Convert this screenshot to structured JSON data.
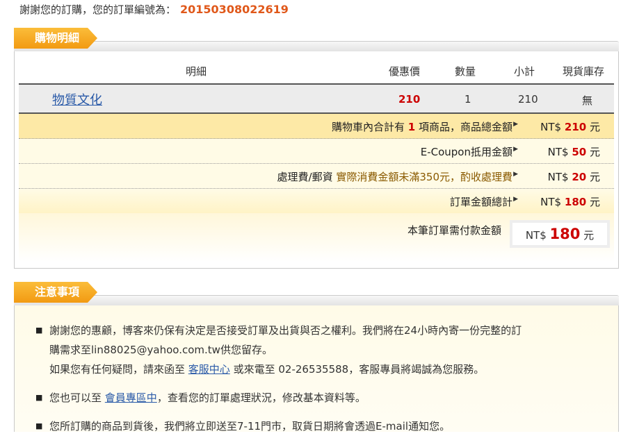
{
  "header": {
    "thanks_text": "謝謝您的訂購，您的訂單編號為：",
    "order_number": "20150308022619"
  },
  "section_details": {
    "title": "購物明細",
    "columns": [
      "明細",
      "優惠價",
      "數量",
      "小計",
      "現貨庫存"
    ],
    "items": [
      {
        "name": "物質文化",
        "price": "210",
        "qty": "1",
        "subtotal": "210",
        "stock": "無"
      }
    ],
    "summary": {
      "cart_prefix": "購物車內合計有",
      "cart_count": "1",
      "cart_suffix": "項商品，商品總金額",
      "cart_amount_prefix": "NT$",
      "cart_amount": "210",
      "cart_unit": "元",
      "coupon_label": "E-Coupon抵用金額",
      "coupon_prefix": "NT$",
      "coupon_amount": "50",
      "coupon_unit": "元",
      "fee_label": "處理費/郵資",
      "fee_note": "實際消費金額未滿350元，酌收處理費",
      "fee_prefix": "NT$",
      "fee_amount": "20",
      "fee_unit": "元",
      "total_label": "訂單金額總計",
      "total_prefix": "NT$",
      "total_amount": "180",
      "total_unit": "元",
      "pay_label": "本筆訂單需付款金額",
      "pay_prefix": "NT$",
      "pay_amount": "180",
      "pay_unit": "元"
    },
    "arrow_icon": "triangle-right-icon"
  },
  "section_notes": {
    "title": "注意事項",
    "note1_line1": "謝謝您的惠顧，博客來仍保有決定是否接受訂單及出貨與否之權利。我們將在24小時內寄一份完整的訂",
    "note1_line2": "購需求至lin88025@yahoo.com.tw供您留存。",
    "note1_line3_a": "如果您有任何疑問，請來函至",
    "note1_link": "客服中心",
    "note1_line3_b": "或來電至 02-26535588，客服專員將竭誠為您服務。",
    "note2_a": "您也可以至",
    "note2_link": "會員專區中",
    "note2_b": "，查看您的訂單處理狀況，修改基本資料等。",
    "note3": "您所訂購的商品到貨後，我們將立即送至7-11門市，取貨日期將會透過E-mail通知您。",
    "bullet_icon": "square-bullet-icon"
  },
  "colors": {
    "accent": "#f29a12",
    "price_red": "#cc0000",
    "link_blue": "#2a5aa8",
    "order_orange": "#e0581a"
  }
}
